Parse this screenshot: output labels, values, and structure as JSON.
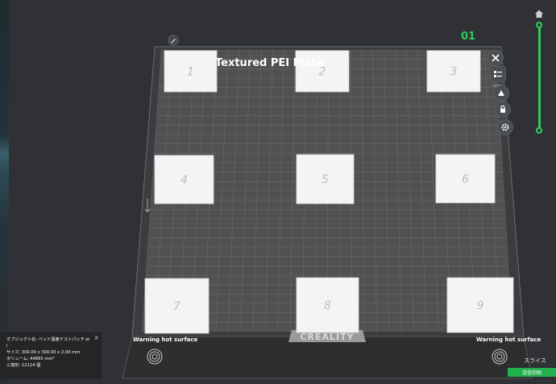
{
  "plate": {
    "title": "Textured PEI Plate",
    "warning_left": "Warning hot surface",
    "warning_right": "Warning hot surface",
    "logo": "CREALITY",
    "patches": [
      "1",
      "2",
      "3",
      "4",
      "5",
      "6",
      "7",
      "8",
      "9"
    ]
  },
  "layer_indicator": "01",
  "toolbar": {
    "close_icon": "close-icon",
    "list_icon": "list-icon",
    "auto_label": "AUTO",
    "auto_icon": "auto-orient-icon",
    "lock_icon": "lock-icon",
    "settings_icon": "gear-icon",
    "edit_icon": "pencil-icon"
  },
  "info_panel": {
    "object_name": "オブジェクト名: ベッド温度テストパッチ.st",
    "object_name_wrap": "l",
    "size": "サイズ: 300.00 x 300.00 x 2.00 mm",
    "volume": "ボリューム: 44865 mm³",
    "triangles": "三角形: 12114 個",
    "close": "X"
  },
  "actions": {
    "slice": "スライス",
    "send": "送信印刷"
  },
  "colors": {
    "background": "#2f3134",
    "accent_green": "#2ecc5a",
    "send_button": "#22b14c",
    "bed_surface": "#515151"
  }
}
